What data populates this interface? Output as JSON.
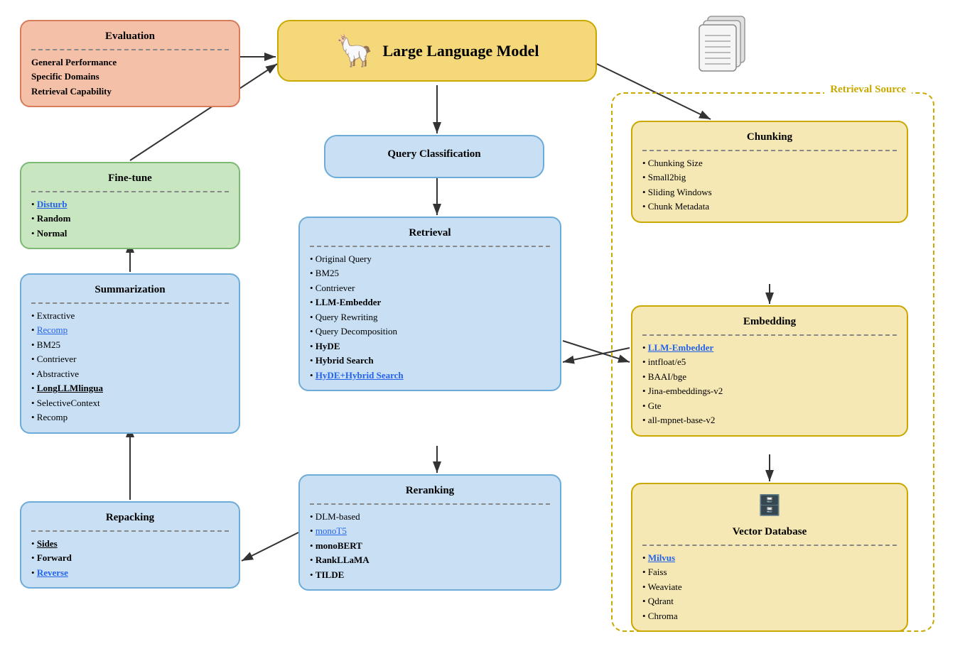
{
  "eval": {
    "title": "Evaluation",
    "items": [
      "General Performance",
      "Specific Domains",
      "Retrieval Capability"
    ]
  },
  "finetune": {
    "title": "Fine-tune",
    "items": [
      {
        "text": "Disturb",
        "style": "link-blue bold"
      },
      {
        "text": "Random",
        "style": "bold"
      },
      {
        "text": "Normal",
        "style": "bold"
      }
    ]
  },
  "summarization": {
    "title": "Summarization",
    "groups": [
      {
        "label": "Extractive",
        "items": [
          {
            "text": "Recomp",
            "style": "link-blue",
            "indent": 1
          },
          {
            "text": "BM25",
            "style": "normal",
            "indent": 1
          },
          {
            "text": "Contriever",
            "style": "normal",
            "indent": 1
          }
        ]
      },
      {
        "label": "Abstractive",
        "items": [
          {
            "text": "LongLLMlingua",
            "style": "bold-ul",
            "indent": 1
          },
          {
            "text": "SelectiveContext",
            "style": "normal",
            "indent": 1
          },
          {
            "text": "Recomp",
            "style": "normal",
            "indent": 1
          }
        ]
      }
    ]
  },
  "repacking": {
    "title": "Repacking",
    "items": [
      {
        "text": "Sides",
        "style": "bold-ul"
      },
      {
        "text": "Forward",
        "style": "bold"
      },
      {
        "text": "Reverse",
        "style": "link-blue bold"
      }
    ]
  },
  "llm": {
    "title": "Large Language Model"
  },
  "query": {
    "title": "Query Classification"
  },
  "retrieval": {
    "title": "Retrieval",
    "items": [
      {
        "text": "Original Query",
        "style": "normal",
        "indent": 0
      },
      {
        "text": "BM25",
        "style": "normal",
        "indent": 1
      },
      {
        "text": "Contriever",
        "style": "normal",
        "indent": 1
      },
      {
        "text": "LLM-Embedder",
        "style": "bold",
        "indent": 1
      },
      {
        "text": "Query Rewriting",
        "style": "normal",
        "indent": 0
      },
      {
        "text": "Query Decomposition",
        "style": "normal",
        "indent": 0
      },
      {
        "text": "HyDE",
        "style": "bold",
        "indent": 0
      },
      {
        "text": "Hybrid Search",
        "style": "bold",
        "indent": 0
      },
      {
        "text": "HyDE+Hybrid Search",
        "style": "link-blue bold",
        "indent": 0
      }
    ]
  },
  "reranking": {
    "title": "Reranking",
    "items": [
      {
        "text": "DLM-based",
        "style": "normal",
        "indent": 0
      },
      {
        "text": "monoT5",
        "style": "link-blue",
        "indent": 1
      },
      {
        "text": "monoBERT",
        "style": "bold",
        "indent": 1
      },
      {
        "text": "RankLLaMA",
        "style": "bold",
        "indent": 1
      },
      {
        "text": "TILDE",
        "style": "bold",
        "indent": 0
      }
    ]
  },
  "retrieval_source": {
    "label": "Retrieval Source"
  },
  "chunking": {
    "title": "Chunking",
    "items": [
      {
        "text": "Chunking Size",
        "style": "normal"
      },
      {
        "text": "Small2big",
        "style": "normal"
      },
      {
        "text": "Sliding Windows",
        "style": "normal"
      },
      {
        "text": "Chunk Metadata",
        "style": "normal"
      }
    ]
  },
  "embedding": {
    "title": "Embedding",
    "items": [
      {
        "text": "LLM-Embedder",
        "style": "link-blue bold"
      },
      {
        "text": "intfloat/e5",
        "style": "normal"
      },
      {
        "text": "BAAI/bge",
        "style": "normal"
      },
      {
        "text": "Jina-embeddings-v2",
        "style": "normal"
      },
      {
        "text": "Gte",
        "style": "normal"
      },
      {
        "text": "all-mpnet-base-v2",
        "style": "normal"
      }
    ]
  },
  "vectordb": {
    "title": "Vector Database",
    "items": [
      {
        "text": "Milvus",
        "style": "link-blue bold"
      },
      {
        "text": "Faiss",
        "style": "normal"
      },
      {
        "text": "Weaviate",
        "style": "normal"
      },
      {
        "text": "Qdrant",
        "style": "normal"
      },
      {
        "text": "Chroma",
        "style": "normal"
      }
    ]
  }
}
